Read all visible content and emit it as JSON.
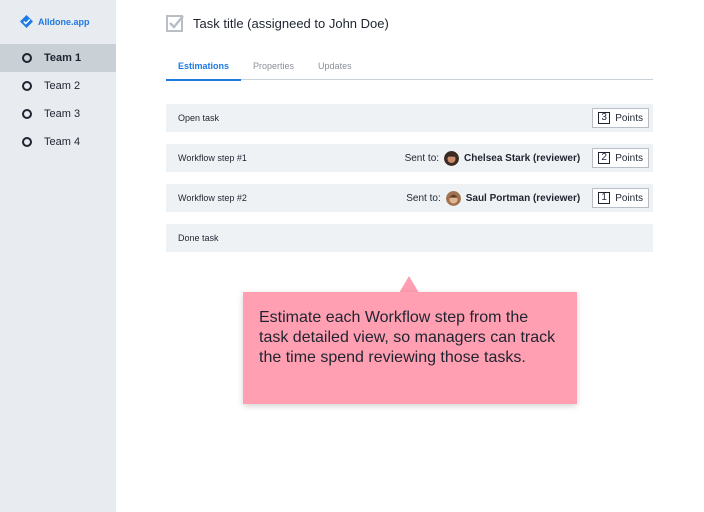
{
  "brand": {
    "name": "Alldone.app",
    "icon": "check-diamond-icon",
    "color": "#1d7ae3"
  },
  "sidebar": {
    "items": [
      {
        "label": "Team 1",
        "active": true
      },
      {
        "label": "Team 2",
        "active": false
      },
      {
        "label": "Team 3",
        "active": false
      },
      {
        "label": "Team 4",
        "active": false
      }
    ]
  },
  "task": {
    "title": "Task title (assigneed to John Doe)",
    "icon": "checked-box-icon"
  },
  "tabs": [
    {
      "label": "Estimations",
      "active": true
    },
    {
      "label": "Properties",
      "active": false
    },
    {
      "label": "Updates",
      "active": false
    }
  ],
  "rows": [
    {
      "label": "Open task",
      "points": "3",
      "points_label": "Points"
    },
    {
      "label": "Workflow step #1",
      "sent_label": "Sent to:",
      "person": "Chelsea Stark (reviewer)",
      "points": "2",
      "points_label": "Points"
    },
    {
      "label": "Workflow step #2",
      "sent_label": "Sent to:",
      "person": "Saul Portman (reviewer)",
      "points": "1",
      "points_label": "Points"
    },
    {
      "label": "Done task"
    }
  ],
  "tooltip": {
    "text": "Estimate each Workflow step from the task detailed view, so managers can track the time spend reviewing those tasks.",
    "color": "#ff9fb1"
  }
}
